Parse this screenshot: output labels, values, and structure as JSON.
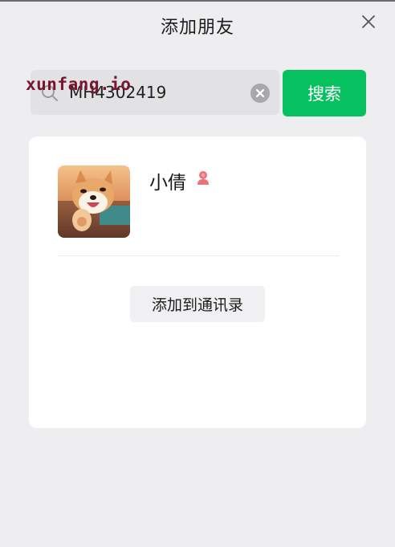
{
  "dialog": {
    "title": "添加朋友"
  },
  "search": {
    "value": "MH4302419",
    "button_label": "搜索"
  },
  "watermark": {
    "text": "xunfang.io"
  },
  "result": {
    "name": "小倩",
    "gender": "female",
    "gender_color": "#e8747c",
    "add_button_label": "添加到通讯录"
  },
  "colors": {
    "accent": "#07c160",
    "background": "#eeeef0",
    "card": "#ffffff"
  }
}
